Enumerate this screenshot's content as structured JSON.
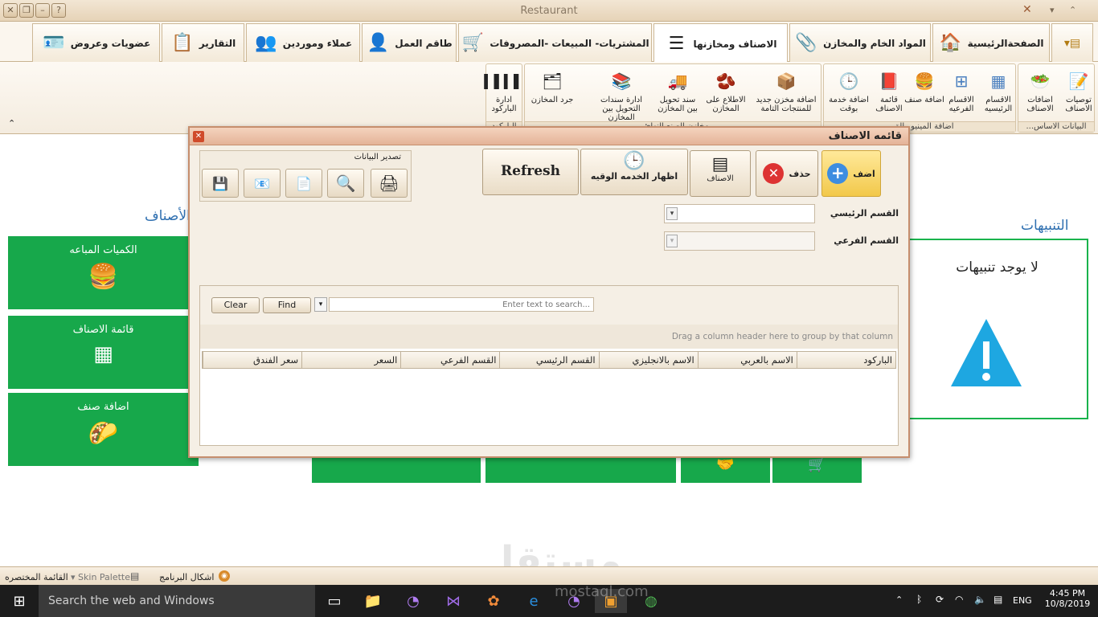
{
  "window": {
    "title": "Restaurant"
  },
  "tabs": [
    {
      "label": "الصفحةالرئيسية",
      "icon": "house-icon"
    },
    {
      "label": "المواد الخام والمخازن",
      "icon": "paperclip-icon"
    },
    {
      "label": "الاصناف ومخازنها",
      "icon": "list-icon",
      "active": true
    },
    {
      "label": "المشتريات- المبيعات -المصروفات",
      "icon": "cart-icon"
    },
    {
      "label": "طاقم العمل",
      "icon": "person-icon"
    },
    {
      "label": "عملاء وموردين",
      "icon": "people-icon"
    },
    {
      "label": "التقارير",
      "icon": "clipboard-icon"
    },
    {
      "label": "عضويات وعروض",
      "icon": "id-card-icon"
    }
  ],
  "ribbon": {
    "groups": [
      {
        "label": "البيانات الاساس...",
        "items": [
          "توصيات الاصناف",
          "اضافات الاصناف"
        ]
      },
      {
        "label": "اضافة المينيو والق...",
        "items": [
          "الاقسام الرئيسيه",
          "الاقسام الفرعيه",
          "اضافة صنف",
          "قائمة الاصناف",
          "اضافة خدمة بوقت"
        ]
      },
      {
        "label": "مخازن الصنع النهائ...",
        "items": [
          "اضافة مخزن جديد للمنتجات التامة",
          "الاطلاع على المخازن",
          "سند تحويل بين المخازن",
          "ادارة سندات التحويل بين المخازن",
          "جرد المخازن"
        ]
      },
      {
        "label": "الباركود",
        "items": [
          "ادارة الباركود"
        ]
      }
    ]
  },
  "dashboard": {
    "items_title": "الأصناف",
    "alerts_title": "التنبيهات",
    "alerts_message": "لا يوجد تنبيهات",
    "tiles": [
      {
        "label": "الكميات المباعه",
        "icon": "burger-icon"
      },
      {
        "label": "قائمة الاصناف",
        "icon": "grid-icon"
      },
      {
        "label": "اضافة صنف",
        "icon": "taco-icon"
      }
    ]
  },
  "dialog": {
    "title": "قائمه الاصناف",
    "buttons": {
      "add": "اضف",
      "delete": "حذف",
      "items": "الاصناف",
      "show_timed": "اظهار الخدمه الوقيه",
      "refresh": "Refresh"
    },
    "export": {
      "label": "تصدير البيانات",
      "items": [
        "print-icon",
        "preview-icon",
        "pdf-icon",
        "xlsx-mail-icon",
        "xls-save-icon"
      ]
    },
    "fields": {
      "main_section": {
        "label": "القسم الرئيسي",
        "value": ""
      },
      "sub_section": {
        "label": "القسم الفرعي",
        "value": ""
      }
    },
    "grid": {
      "search_placeholder": "Enter text to search...",
      "find_label": "Find",
      "clear_label": "Clear",
      "group_hint": "Drag a column header here to group by that column",
      "columns": [
        "الباركود",
        "الاسم بالعربي",
        "الاسم بالانجليزي",
        "القسم الرئيسي",
        "القسم الفرعي",
        "السعر",
        "سعر الفندق"
      ]
    }
  },
  "statusbar": {
    "menu": "القائمة المختصره",
    "skin_palette": "Skin Palette",
    "program_skins": "اشكال البرنامج"
  },
  "taskbar": {
    "search": "Search the web and Windows",
    "language": "ENG",
    "time": "4:45 PM",
    "date": "10/8/2019"
  },
  "watermark": {
    "text_ar": "مستقل",
    "text_en": "mostaql.com"
  },
  "colors": {
    "tile_green": "#17a84b",
    "accent_blue": "#2e6fb0"
  }
}
